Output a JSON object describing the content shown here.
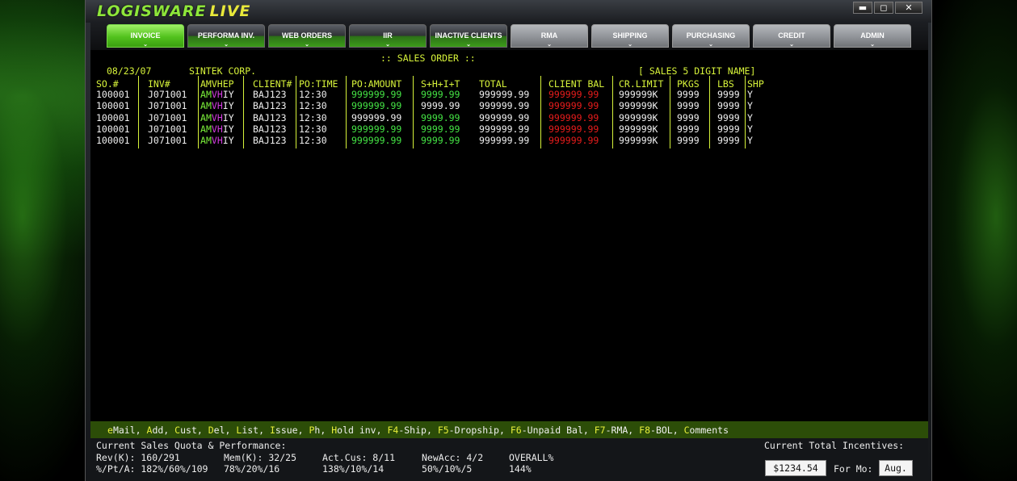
{
  "app": {
    "logo_a": "LOGISWARE",
    "logo_b": "LIVE"
  },
  "window_controls": {
    "minimize": "▬",
    "maximize": "◻",
    "close": "✕"
  },
  "nav": [
    {
      "label": "INVOICE"
    },
    {
      "label": "PERFORMA INV."
    },
    {
      "label": "WEB ORDERS"
    },
    {
      "label": "IIR"
    },
    {
      "label": "INACTIVE CLIENTS"
    },
    {
      "label": "RMA"
    },
    {
      "label": "SHIPPING"
    },
    {
      "label": "PURCHASING"
    },
    {
      "label": "CREDIT"
    },
    {
      "label": "ADMIN"
    }
  ],
  "chevron": "⌄",
  "screen": {
    "title": ":: SALES ORDER ::",
    "date": "08/23/07",
    "company": "SINTEK CORP.",
    "sales_name": "[ SALES 5 DIGIT NAME]"
  },
  "table": {
    "headers": [
      "SO.#",
      "INV#",
      "AMVHEP",
      "CLIENT#",
      "PO:TIME",
      "PO:AMOUNT",
      "S+H+I+T",
      "TOTAL",
      "CLIENT BAL",
      "CR.LIMIT",
      "PKGS",
      "LBS",
      "SHP"
    ],
    "rows": [
      [
        "100001",
        "J071001",
        "AMVHIY",
        "BAJ123",
        "12:30",
        "999999.99",
        "9999.99",
        "999999.99",
        "999999.99",
        "999999K",
        "9999",
        "9999",
        "Y"
      ],
      [
        "100001",
        "J071001",
        "AMVHIY",
        "BAJ123",
        "12:30",
        "999999.99",
        "9999.99",
        "999999.99",
        "999999.99",
        "999999K",
        "9999",
        "9999",
        "Y"
      ],
      [
        "100001",
        "J071001",
        "AMVHIY",
        "BAJ123",
        "12:30",
        "999999.99",
        "9999.99",
        "999999.99",
        "999999.99",
        "999999K",
        "9999",
        "9999",
        "Y"
      ],
      [
        "100001",
        "J071001",
        "AMVHIY",
        "BAJ123",
        "12:30",
        "999999.99",
        "9999.99",
        "999999.99",
        "999999.99",
        "999999K",
        "9999",
        "9999",
        "Y"
      ],
      [
        "100001",
        "J071001",
        "AMVHIY",
        "BAJ123",
        "12:30",
        "999999.99",
        "9999.99",
        "999999.99",
        "999999.99",
        "999999K",
        "9999",
        "9999",
        "Y"
      ]
    ],
    "po_amount_color": [
      "#45e545",
      "#45e545",
      "#f0f0f0",
      "#45e545",
      "#45e545"
    ],
    "shit_color": [
      "#45e545",
      "#f0f0f0",
      "#45e545",
      "#45e545",
      "#45e545"
    ]
  },
  "commands": [
    {
      "key": "e",
      "rest": "Mail,"
    },
    {
      "key": "A",
      "rest": "dd,"
    },
    {
      "key": "C",
      "rest": "ust,"
    },
    {
      "key": "D",
      "rest": "el,"
    },
    {
      "key": "L",
      "rest": "ist,"
    },
    {
      "key": "I",
      "rest": "ssue,"
    },
    {
      "key": "P",
      "rest": "h,"
    },
    {
      "key": "H",
      "rest": "old inv,"
    },
    {
      "key": "F4",
      "rest": "-Ship,"
    },
    {
      "key": "F5",
      "rest": "-Dropship,"
    },
    {
      "key": "F6",
      "rest": "-Unpaid Bal,"
    },
    {
      "key": "F7",
      "rest": "-RMA,"
    },
    {
      "key": "F8",
      "rest": "-BOL,"
    },
    {
      "key": "C",
      "rest": "omments"
    }
  ],
  "status": {
    "quota_title": "Current Sales Quota & Performance:",
    "incentives_title": "Current Total Incentives:",
    "rev": "Rev(K): 160/291",
    "pta": "%/Pt/A: 182%/60%/109",
    "mem": "Mem(K): 32/25",
    "mem_pct": "78%/20%/16",
    "actcus": "Act.Cus: 8/11",
    "actcus_pct": "138%/10%/14",
    "newacc": "NewAcc: 4/2",
    "newacc_pct": "50%/10%/5",
    "overall": "OVERALL%",
    "overall_pct": "144%",
    "incentive_value": "$1234.54",
    "for_mo_label": "For Mo:",
    "month": "Aug."
  },
  "colors": {
    "accent_green": "#52c21d",
    "terminal_yellow": "#d6f23a",
    "balance_red": "#e81c1c",
    "cmd_bar": "#2c4d08"
  }
}
